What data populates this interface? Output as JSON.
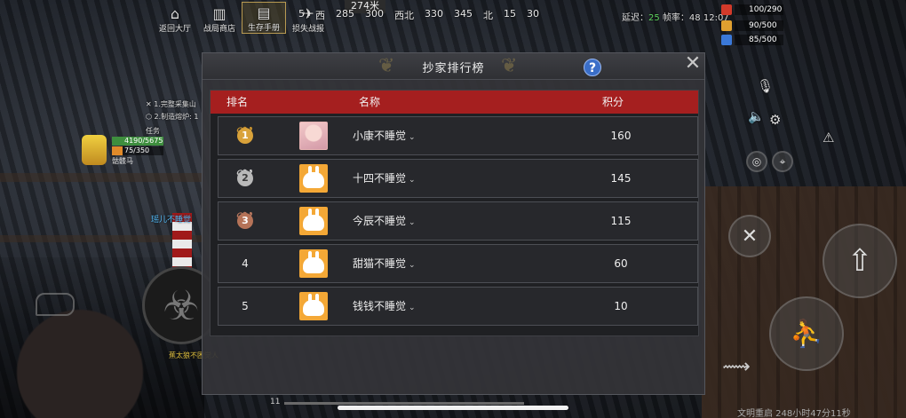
{
  "top_menu": [
    {
      "label": "返回大厅",
      "icon": "⌂"
    },
    {
      "label": "战局商店",
      "icon": "▥"
    },
    {
      "label": "生存手册",
      "icon": "▤",
      "active": true
    },
    {
      "label": "损失战报",
      "icon": "✈"
    }
  ],
  "compass": {
    "distance": "274米",
    "marks": [
      "5",
      "西",
      "285",
      "300",
      "西北",
      "330",
      "345",
      "北",
      "15",
      "30"
    ]
  },
  "top_stats": {
    "latency_label": "延迟：",
    "latency_value": "25",
    "fps_label": "帧率：",
    "fps_value": "48",
    "time": "12:07"
  },
  "resources": [
    {
      "value": "100/290",
      "color": "#d23a2a"
    },
    {
      "value": "90/500",
      "color": "#e0a030"
    },
    {
      "value": "85/500",
      "color": "#3a78d8"
    }
  ],
  "quests": [
    "1.完整采集山",
    "2.制造熔炉: 1"
  ],
  "player": {
    "section_label": "任务",
    "hp": "4190/5675",
    "food": "75/350",
    "tag": "骷髅马"
  },
  "world_labels": {
    "team_name": "瑶儿不睡觉",
    "yellow_name": "蕉太狼不困觉人"
  },
  "bottom": {
    "civ_text": "文明重启 248小时47分11秒",
    "left_num": "11"
  },
  "leaderboard": {
    "title": "抄家排行榜",
    "help": "?",
    "close": "✕",
    "headers": {
      "rank": "排名",
      "name": "名称",
      "score": "积分"
    },
    "rows": [
      {
        "rank": "1",
        "name": "小康不睡觉",
        "score": "160"
      },
      {
        "rank": "2",
        "name": "十四不睡觉",
        "score": "145"
      },
      {
        "rank": "3",
        "name": "今辰不睡觉",
        "score": "115"
      },
      {
        "rank": "4",
        "name": "甜猫不睡觉",
        "score": "60"
      },
      {
        "rank": "5",
        "name": "钱钱不睡觉",
        "score": "10"
      }
    ]
  }
}
